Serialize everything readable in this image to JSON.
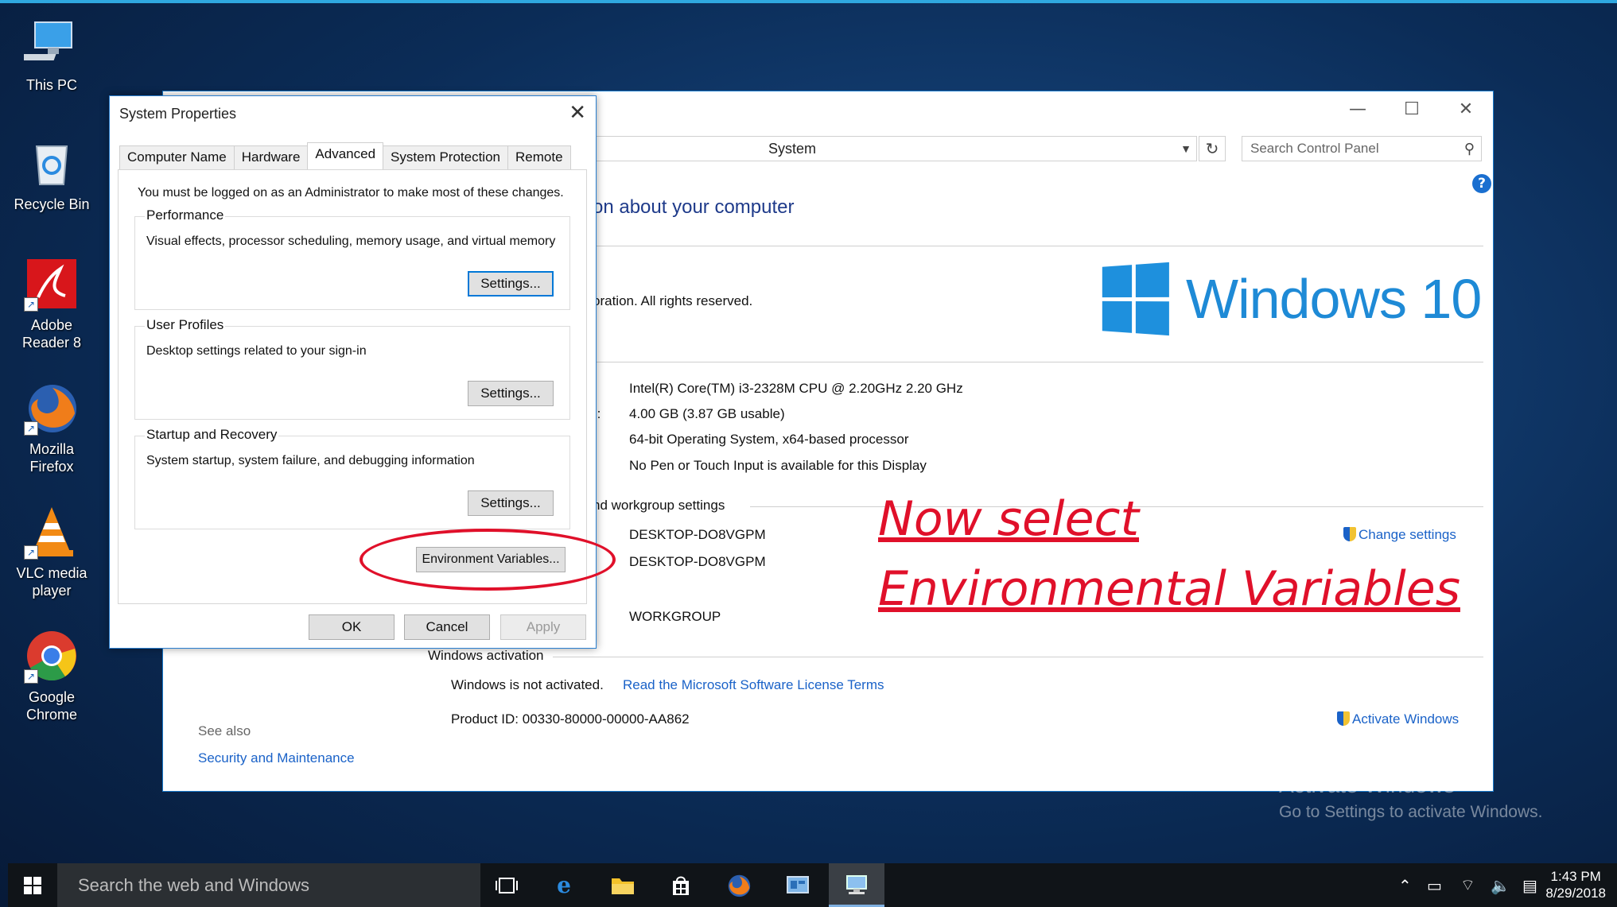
{
  "desktop": {
    "icons": [
      {
        "label": "This PC"
      },
      {
        "label": "Recycle Bin"
      },
      {
        "label": "Adobe Reader 8"
      },
      {
        "label": "Mozilla Firefox"
      },
      {
        "label": "VLC media player"
      },
      {
        "label": "Google Chrome"
      }
    ]
  },
  "system_window": {
    "address": "System",
    "search_placeholder": "Search Control Panel",
    "help": "?",
    "heading": "on about your computer",
    "copyright": "oration. All rights reserved.",
    "windows_logo_text": "Windows 10",
    "processor": "Intel(R) Core(TM) i3-2328M CPU @ 2.20GHz   2.20 GHz",
    "ram_label": "):",
    "ram": "4.00 GB (3.87 GB usable)",
    "system_type": "64-bit Operating System, x64-based processor",
    "pen_touch": "No Pen or Touch Input is available for this Display",
    "workgroup_section": "nd workgroup settings",
    "computer_name": "DESKTOP-DO8VGPM",
    "full_name": "DESKTOP-DO8VGPM",
    "workgroup": "WORKGROUP",
    "change_settings": "Change settings",
    "activation_section": "Windows activation",
    "not_activated": "Windows is not activated.",
    "license_link": "Read the Microsoft Software License Terms",
    "product_id": "Product ID:  00330-80000-00000-AA862",
    "activate_link": "Activate Windows",
    "see_also": "See also",
    "security_link": "Security and Maintenance"
  },
  "annotation": {
    "line1": "Now select",
    "line2": "Environmental Variables"
  },
  "watermark": {
    "line1": "Activate Windows",
    "line2": "Go to Settings to activate Windows."
  },
  "dialog": {
    "title": "System Properties",
    "tabs": [
      "Computer Name",
      "Hardware",
      "Advanced",
      "System Protection",
      "Remote"
    ],
    "admin_note": "You must be logged on as an Administrator to make most of these changes.",
    "performance": {
      "title": "Performance",
      "desc": "Visual effects, processor scheduling, memory usage, and virtual memory",
      "button": "Settings..."
    },
    "user_profiles": {
      "title": "User Profiles",
      "desc": "Desktop settings related to your sign-in",
      "button": "Settings..."
    },
    "startup": {
      "title": "Startup and Recovery",
      "desc": "System startup, system failure, and debugging information",
      "button": "Settings..."
    },
    "env_button": "Environment Variables...",
    "ok": "OK",
    "cancel": "Cancel",
    "apply": "Apply"
  },
  "taskbar": {
    "search_placeholder": "Search the web and Windows",
    "time": "1:43 PM",
    "date": "8/29/2018"
  }
}
